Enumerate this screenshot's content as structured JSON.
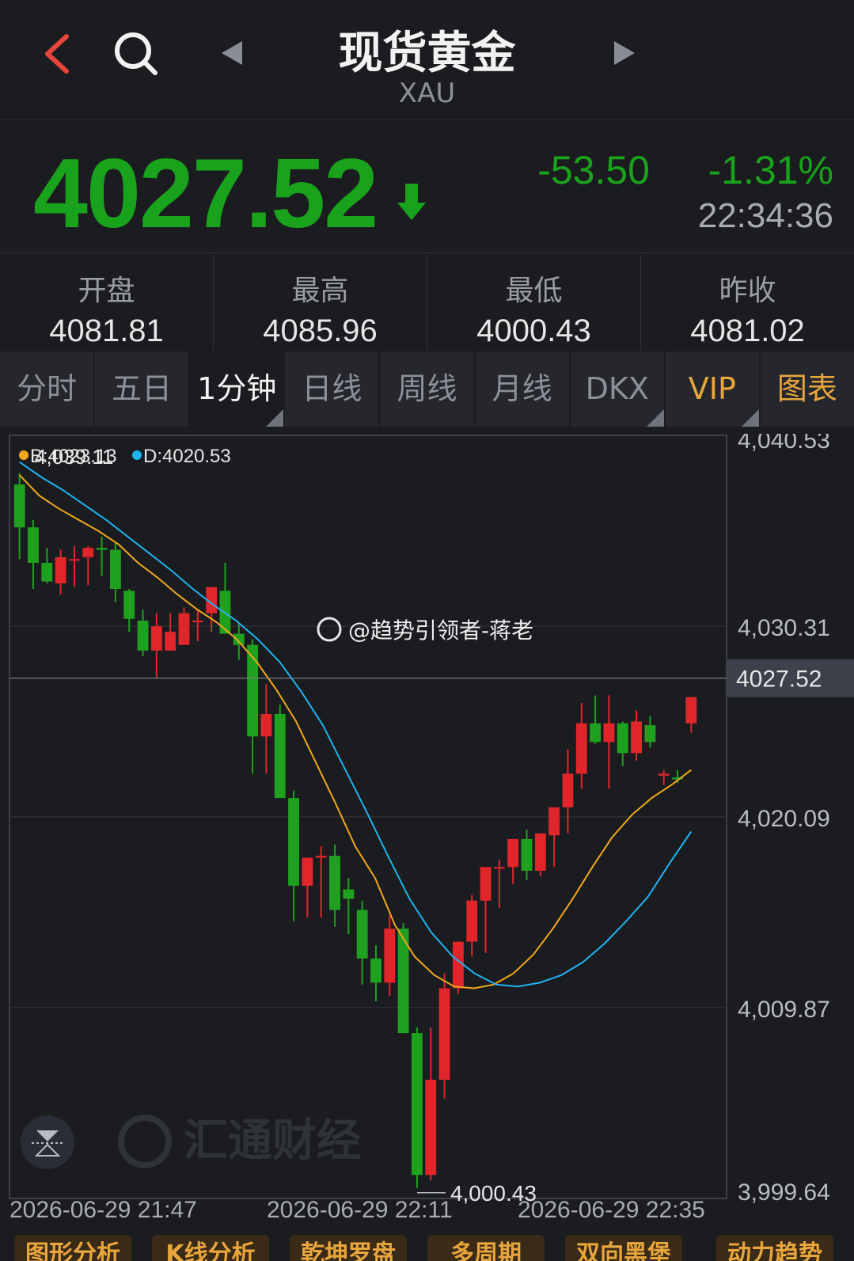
{
  "header": {
    "title": "现货黄金",
    "subtitle": "XAU"
  },
  "quote": {
    "price": "4027.52",
    "change": "-53.50",
    "change_pct": "-1.31%",
    "time": "22:34:36",
    "color_down": "#19a21b"
  },
  "stats": [
    {
      "label": "开盘",
      "value": "4081.81"
    },
    {
      "label": "最高",
      "value": "4085.96"
    },
    {
      "label": "最低",
      "value": "4000.43"
    },
    {
      "label": "昨收",
      "value": "4081.02"
    }
  ],
  "tabs": [
    {
      "label": "分时",
      "active": false,
      "corner": false,
      "gold": false
    },
    {
      "label": "五日",
      "active": false,
      "corner": false,
      "gold": false
    },
    {
      "label": "1分钟",
      "active": true,
      "corner": true,
      "gold": false
    },
    {
      "label": "日线",
      "active": false,
      "corner": false,
      "gold": false
    },
    {
      "label": "周线",
      "active": false,
      "corner": false,
      "gold": false
    },
    {
      "label": "月线",
      "active": false,
      "corner": false,
      "gold": false
    },
    {
      "label": "DKX",
      "active": false,
      "corner": true,
      "gold": false
    },
    {
      "label": "VIP",
      "active": false,
      "corner": true,
      "gold": true
    },
    {
      "label": "图表",
      "active": false,
      "corner": false,
      "gold": true
    }
  ],
  "bottom_tabs": [
    "图形分析",
    "K线分析",
    "乾坤罗盘",
    "多周期",
    "双向黑堡",
    "动力趋势"
  ],
  "watermark": {
    "weibo": "@趋势引领者-蒋老",
    "logo_text": "汇通财经"
  },
  "chart_data": {
    "type": "candlestick",
    "ylim": [
      3999.64,
      4040.53
    ],
    "y_ticks": [
      "4,040.53",
      "4,030.31",
      "4,020.09",
      "4,009.87",
      "3,999.64"
    ],
    "current_price_label": "4027.52",
    "current_price": 4027.52,
    "min_label": "4,000.43",
    "max_label": "4,039.11",
    "x_labels": [
      "2026-06-29 21:47",
      "2026-06-29 22:11",
      "2026-06-29 22:35"
    ],
    "legend": [
      {
        "name": "B:4023.13",
        "color": "#f0a81a"
      },
      {
        "name": "D:4020.53",
        "color": "#1fb3ef"
      }
    ],
    "candles": [
      [
        4037.9,
        4038.5,
        4033.9,
        4035.6
      ],
      [
        4035.6,
        4036.0,
        4032.3,
        4033.7
      ],
      [
        4033.7,
        4034.5,
        4032.6,
        4032.7
      ],
      [
        4032.6,
        4034.4,
        4032.0,
        4034.0
      ],
      [
        4033.9,
        4034.6,
        4032.4,
        4033.9
      ],
      [
        4034.0,
        4034.6,
        4032.5,
        4034.5
      ],
      [
        4034.5,
        4035.1,
        4033.0,
        4034.4
      ],
      [
        4034.4,
        4034.8,
        4031.6,
        4032.3
      ],
      [
        4032.2,
        4032.3,
        4030.0,
        4030.7
      ],
      [
        4030.6,
        4031.2,
        4028.7,
        4029.0
      ],
      [
        4029.0,
        4031.0,
        4027.5,
        4030.3
      ],
      [
        4029.0,
        4031.0,
        4029.3,
        4030.0
      ],
      [
        4029.3,
        4031.3,
        4029.5,
        4031.0
      ],
      [
        4030.6,
        4031.2,
        4029.5,
        4030.6
      ],
      [
        4031.0,
        4032.2,
        4030.0,
        4032.4
      ],
      [
        4032.2,
        4033.7,
        4030.6,
        4029.9
      ],
      [
        4029.9,
        4030.5,
        4028.5,
        4029.3
      ],
      [
        4029.3,
        4029.6,
        4022.4,
        4024.4
      ],
      [
        4024.4,
        4027.2,
        4022.4,
        4025.6
      ],
      [
        4025.6,
        4026.1,
        4021.6,
        4021.1
      ],
      [
        4021.1,
        4021.5,
        4014.5,
        4016.4
      ],
      [
        4016.4,
        4016.8,
        4014.7,
        4017.9
      ],
      [
        4017.9,
        4018.5,
        4014.7,
        4018.0
      ],
      [
        4018.0,
        4018.6,
        4014.2,
        4015.1
      ],
      [
        4016.2,
        4016.8,
        4013.8,
        4015.7
      ],
      [
        4015.1,
        4015.6,
        4011.1,
        4012.5
      ],
      [
        4012.5,
        4013.2,
        4010.2,
        4011.2
      ],
      [
        4011.2,
        4014.8,
        4010.5,
        4014.1
      ],
      [
        4014.1,
        4014.4,
        4008.8,
        4008.5
      ],
      [
        4008.5,
        4008.8,
        4000.2,
        4000.9
      ],
      [
        4000.9,
        4008.8,
        4000.6,
        4006.0
      ],
      [
        4006.0,
        4011.7,
        4005.0,
        4010.9
      ],
      [
        4010.9,
        4013.2,
        4010.6,
        4013.4
      ],
      [
        4013.4,
        4015.9,
        4012.6,
        4015.6
      ],
      [
        4015.6,
        4016.4,
        4012.8,
        4017.4
      ],
      [
        4017.4,
        4017.8,
        4015.2,
        4017.4
      ],
      [
        4017.4,
        4018.4,
        4016.5,
        4018.9
      ],
      [
        4018.9,
        4019.4,
        4016.7,
        4017.2
      ],
      [
        4017.2,
        4019.2,
        4016.9,
        4019.2
      ],
      [
        4019.1,
        4019.5,
        4017.4,
        4020.6
      ],
      [
        4020.6,
        4023.7,
        4019.2,
        4022.4
      ],
      [
        4022.4,
        4026.2,
        4021.6,
        4025.1
      ],
      [
        4025.1,
        4026.6,
        4024.0,
        4024.1
      ],
      [
        4024.1,
        4026.6,
        4021.6,
        4025.1
      ],
      [
        4025.1,
        4025.2,
        4022.8,
        4023.5
      ],
      [
        4023.5,
        4025.8,
        4023.1,
        4025.2
      ],
      [
        4025.0,
        4025.5,
        4023.8,
        4024.1
      ],
      [
        4022.3,
        4022.6,
        4021.8,
        4022.4
      ],
      [
        4022.2,
        4022.6,
        4021.9,
        4022.1
      ],
      [
        4025.1,
        4026.5,
        4024.6,
        4026.5
      ]
    ],
    "series": [
      {
        "name": "B",
        "color": "#f0a81a",
        "values": [
          4038.4,
          4037.3,
          4036.6,
          4036.0,
          4035.4,
          4034.7,
          4033.7,
          4032.9,
          4032.0,
          4031.2,
          4030.5,
          4029.6,
          4028.4,
          4026.9,
          4025.2,
          4023.0,
          4020.8,
          4018.5,
          4016.8,
          4014.3,
          4012.6,
          4011.6,
          4011.0,
          4010.9,
          4011.1,
          4011.7,
          4012.7,
          4014.1,
          4015.7,
          4017.4,
          4019.0,
          4020.2,
          4021.1,
          4021.8,
          4022.6
        ]
      },
      {
        "name": "D",
        "color": "#1fb3ef",
        "values": [
          4039.1,
          4038.3,
          4037.6,
          4036.8,
          4036.0,
          4035.1,
          4034.2,
          4033.3,
          4032.3,
          4031.4,
          4030.6,
          4029.6,
          4028.4,
          4026.8,
          4025.0,
          4022.7,
          4020.4,
          4018.0,
          4015.7,
          4013.9,
          4012.6,
          4011.7,
          4011.1,
          4011.0,
          4011.2,
          4011.6,
          4012.3,
          4013.3,
          4014.5,
          4015.8,
          4017.6,
          4019.3
        ]
      }
    ]
  }
}
